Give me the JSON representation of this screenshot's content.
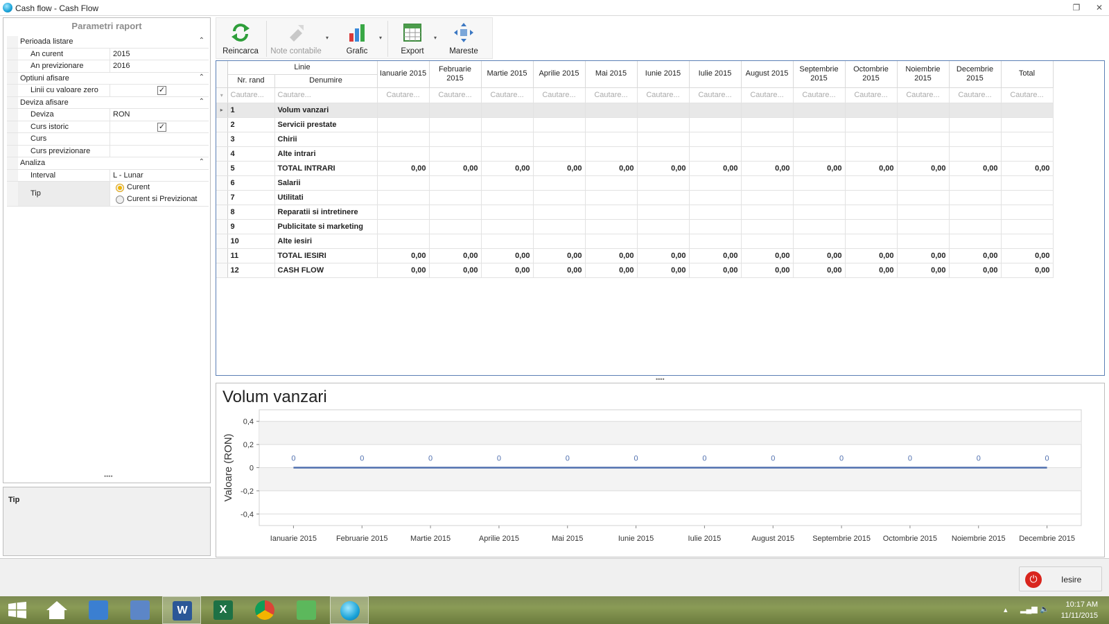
{
  "window": {
    "title": "Cash flow - Cash Flow"
  },
  "params": {
    "header": "Parametri raport",
    "cat1": "Perioada listare",
    "an_curent_label": "An curent",
    "an_curent_value": "2015",
    "an_prev_label": "An previzionare",
    "an_prev_value": "2016",
    "cat2": "Optiuni afisare",
    "linii_zero_label": "Linii cu valoare zero",
    "linii_zero_checked": true,
    "cat3": "Deviza afisare",
    "deviza_label": "Deviza",
    "deviza_value": "RON",
    "curs_istoric_label": "Curs istoric",
    "curs_istoric_checked": true,
    "curs_label": "Curs",
    "curs_value": "",
    "curs_prev_label": "Curs previzionare",
    "curs_prev_value": "",
    "cat4": "Analiza",
    "interval_label": "Interval",
    "interval_value": "L - Lunar",
    "tip_label": "Tip",
    "tip_opt1": "Curent",
    "tip_opt2": "Curent si Previzionat"
  },
  "tip_panel": {
    "label": "Tip"
  },
  "toolbar": {
    "reincarca": "Reincarca",
    "note": "Note contabile",
    "grafic": "Grafic",
    "export": "Export",
    "mareste": "Mareste"
  },
  "grid": {
    "linie": "Linie",
    "nr_rand": "Nr. rand",
    "denumire": "Denumire",
    "months": [
      "Ianuarie 2015",
      "Februarie 2015",
      "Martie 2015",
      "Aprilie 2015",
      "Mai 2015",
      "Iunie 2015",
      "Iulie 2015",
      "August 2015",
      "Septembrie 2015",
      "Octombrie 2015",
      "Noiembrie 2015",
      "Decembrie 2015",
      "Total"
    ],
    "search": "Cautare...",
    "rows": [
      {
        "nr": "1",
        "name": "Volum vanzari",
        "values": []
      },
      {
        "nr": "2",
        "name": "Servicii prestate",
        "values": []
      },
      {
        "nr": "3",
        "name": "Chirii",
        "values": []
      },
      {
        "nr": "4",
        "name": "Alte intrari",
        "values": []
      },
      {
        "nr": "5",
        "name": "TOTAL INTRARI",
        "values": [
          "0,00",
          "0,00",
          "0,00",
          "0,00",
          "0,00",
          "0,00",
          "0,00",
          "0,00",
          "0,00",
          "0,00",
          "0,00",
          "0,00",
          "0,00"
        ]
      },
      {
        "nr": "6",
        "name": "Salarii",
        "values": []
      },
      {
        "nr": "7",
        "name": "Utilitati",
        "values": []
      },
      {
        "nr": "8",
        "name": "Reparatii si intretinere",
        "values": []
      },
      {
        "nr": "9",
        "name": "Publicitate si marketing",
        "values": []
      },
      {
        "nr": "10",
        "name": "Alte iesiri",
        "values": []
      },
      {
        "nr": "11",
        "name": "TOTAL IESIRI",
        "values": [
          "0,00",
          "0,00",
          "0,00",
          "0,00",
          "0,00",
          "0,00",
          "0,00",
          "0,00",
          "0,00",
          "0,00",
          "0,00",
          "0,00",
          "0,00"
        ]
      },
      {
        "nr": "12",
        "name": "CASH FLOW",
        "values": [
          "0,00",
          "0,00",
          "0,00",
          "0,00",
          "0,00",
          "0,00",
          "0,00",
          "0,00",
          "0,00",
          "0,00",
          "0,00",
          "0,00",
          "0,00"
        ]
      }
    ]
  },
  "chart_data": {
    "type": "line",
    "title": "Volum vanzari",
    "ylabel": "Valoare (RON)",
    "xlabel": "",
    "categories": [
      "Ianuarie 2015",
      "Februarie 2015",
      "Martie 2015",
      "Aprilie 2015",
      "Mai 2015",
      "Iunie 2015",
      "Iulie 2015",
      "August 2015",
      "Septembrie 2015",
      "Octombrie 2015",
      "Noiembrie 2015",
      "Decembrie 2015"
    ],
    "series": [
      {
        "values": [
          0,
          0,
          0,
          0,
          0,
          0,
          0,
          0,
          0,
          0,
          0,
          0
        ]
      }
    ],
    "yticks": [
      "0,4",
      "0,2",
      "0",
      "-0,2",
      "-0,4"
    ],
    "ylim": [
      -0.5,
      0.5
    ],
    "data_labels": [
      "0",
      "0",
      "0",
      "0",
      "0",
      "0",
      "0",
      "0",
      "0",
      "0",
      "0",
      "0"
    ],
    "line_color": "#4f6fae",
    "grid": true
  },
  "footer": {
    "exit": "Iesire"
  },
  "taskbar": {
    "time": "10:17 AM",
    "date": "11/11/2015"
  }
}
